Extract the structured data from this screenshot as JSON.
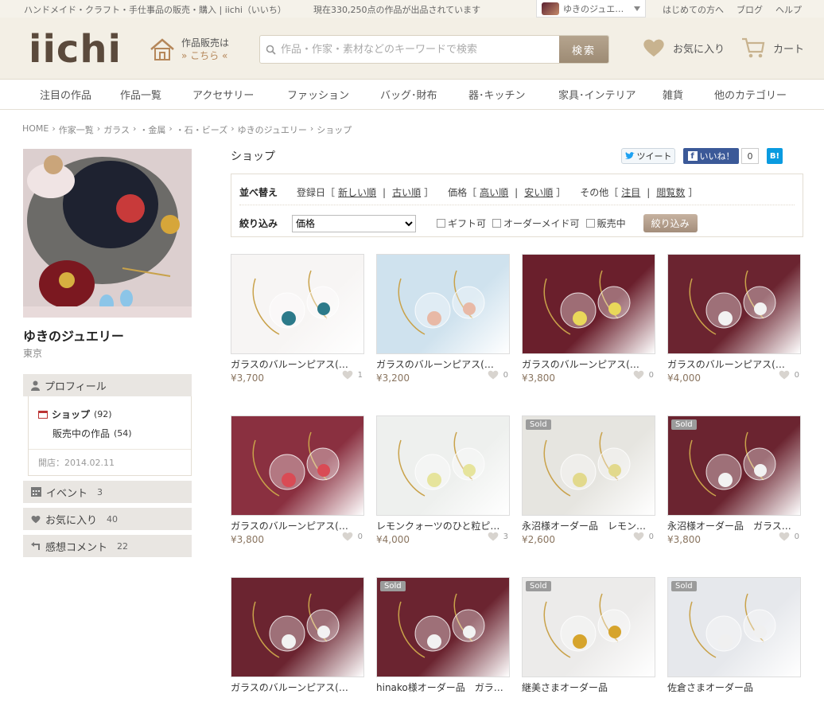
{
  "topbar": {
    "tagline": "ハンドメイド・クラフト・手仕事品の販売・購入 | iichi（いいち）",
    "count": "現在330,250点の作品が出品されています",
    "user": "ゆきのジュエ…",
    "links": [
      "はじめての方へ",
      "ブログ",
      "ヘルプ"
    ]
  },
  "header": {
    "logo": "iichi",
    "sell_line1": "作品販売は",
    "sell_line2": "» こちら «",
    "search_placeholder": "作品・作家・素材などのキーワードで検索",
    "search_button": "検索",
    "favorites": "お気に入り",
    "cart": "カート"
  },
  "nav": [
    "注目の作品",
    "作品一覧",
    "アクセサリー",
    "ファッション",
    "バッグ･財布",
    "器･キッチン",
    "家具･インテリア",
    "雑貨",
    "他のカテゴリー"
  ],
  "breadcrumb": [
    "HOME",
    "›",
    "作家一覧",
    "›",
    "ガラス",
    "›",
    "・金属",
    "›",
    "・石・ビーズ",
    "›",
    "ゆきのジュエリー",
    "›",
    "ショップ"
  ],
  "shop": {
    "name": "ゆきのジュエリー",
    "location": "東京",
    "profile": "プロフィール",
    "shop_label": "ショップ",
    "shop_count": "(92)",
    "on_sale_label": "販売中の作品",
    "on_sale_count": "(54)",
    "opened": "開店：2014.02.11",
    "events": "イベント",
    "events_count": "3",
    "favorites": "お気に入り",
    "favorites_count": "40",
    "comments": "感想コメント",
    "comments_count": "22"
  },
  "main": {
    "title": "ショップ",
    "tweet": "ツイート",
    "like": "いいね！",
    "like_count": "0",
    "hatena": "B!",
    "sort_label": "並べ替え",
    "sort_date": "登録日［",
    "sort_new": "新しい順",
    "sort_old": "古い順",
    "sort_price": "価格［",
    "sort_high": "高い順",
    "sort_low": "安い順",
    "sort_other": "その他［",
    "sort_featured": "注目",
    "sort_views": "閲覧数",
    "close_bracket": "］",
    "sep": "|",
    "filter_label": "絞り込み",
    "filter_select": "価格",
    "gift": "ギフト可",
    "order": "オーダーメイド可",
    "onsale": "販売中",
    "filter_button": "絞り込み"
  },
  "products": [
    {
      "name": "ガラスのバルーンピアス(…",
      "price": "¥3,700",
      "likes": "1",
      "sold": "",
      "bg": "#f7f5f4",
      "glass": "#2c7a8a"
    },
    {
      "name": "ガラスのバルーンピアス(…",
      "price": "¥3,200",
      "likes": "0",
      "sold": "",
      "bg": "#cfe2ee",
      "glass": "#e8b9a6"
    },
    {
      "name": "ガラスのバルーンピアス(…",
      "price": "¥3,800",
      "likes": "0",
      "sold": "",
      "bg": "#6a1f2c",
      "glass": "#e9d85a"
    },
    {
      "name": "ガラスのバルーンピアス(…",
      "price": "¥4,000",
      "likes": "0",
      "sold": "",
      "bg": "#6b2430",
      "glass": "#f2f2f2"
    },
    {
      "name": "ガラスのバルーンピアス(…",
      "price": "¥3,800",
      "likes": "0",
      "sold": "",
      "bg": "#8a3040",
      "glass": "#d94b55"
    },
    {
      "name": "レモンクォーツのひと粒ピ…",
      "price": "¥4,000",
      "likes": "3",
      "sold": "",
      "bg": "#eef0ee",
      "glass": "#e6e49c"
    },
    {
      "name": "永沼様オーダー品　レモン…",
      "price": "¥2,600",
      "likes": "0",
      "sold": "Sold",
      "bg": "#e6e5e0",
      "glass": "#e2d98c"
    },
    {
      "name": "永沼様オーダー品　ガラス…",
      "price": "¥3,800",
      "likes": "0",
      "sold": "Sold",
      "bg": "#6b2430",
      "glass": "#f2f2f2"
    },
    {
      "name": "ガラスのバルーンピアス(…",
      "price": "",
      "likes": "",
      "sold": "",
      "bg": "#6b2430",
      "glass": "#f2f2f2"
    },
    {
      "name": "hinako様オーダー品　ガラ…",
      "price": "",
      "likes": "",
      "sold": "Sold",
      "bg": "#6b2430",
      "glass": "#f2f2f2"
    },
    {
      "name": "継美さまオーダー品",
      "price": "",
      "likes": "",
      "sold": "Sold",
      "bg": "#ecebea",
      "glass": "#d6a42c"
    },
    {
      "name": "佐倉さまオーダー品",
      "price": "",
      "likes": "",
      "sold": "Sold",
      "bg": "#e6e8ec",
      "glass": "#f0f0f0"
    }
  ]
}
